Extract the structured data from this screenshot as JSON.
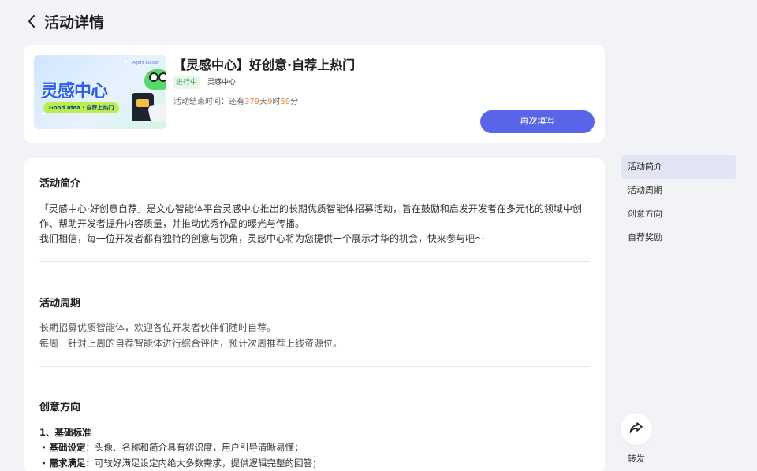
{
  "header": {
    "title": "活动详情"
  },
  "activity": {
    "banner": {
      "title": "灵感中心",
      "pill": "Good Idea · 自荐上热门",
      "small": "Agent Builder"
    },
    "title": "【灵感中心】好创意·自荐上热门",
    "status": "进行中",
    "tag": "灵感中心",
    "end_label": "活动结束时间：还有",
    "days": "379",
    "day_unit": "天",
    "hours": "9",
    "hour_unit": "时",
    "minutes": "59",
    "minute_unit": "分",
    "action": "再次填写"
  },
  "sections": {
    "intro": {
      "heading": "活动简介",
      "p1": "「灵感中心·好创意自荐」是文心智能体平台灵感中心推出的长期优质智能体招募活动，旨在鼓励和启发开发者在多元化的领域中创作、帮助开发者提升内容质量，并推动优秀作品的曝光与传播。",
      "p2": "我们相信，每一位开发者都有独特的创意与视角，灵感中心将为您提供一个展示才华的机会，快来参与吧～"
    },
    "period": {
      "heading": "活动周期",
      "p1": "长期招募优质智能体，欢迎各位开发者伙伴们随时自荐。",
      "p2": "每周一针对上周的自荐智能体进行综合评估，预计次周推荐上线资源位。"
    },
    "direction": {
      "heading": "创意方向",
      "sub": "1、基础标准",
      "b1_key": "基础设定",
      "b1_val": "：头像、名称和简介具有辨识度，用户引导清晰易懂；",
      "b2_key": "需求满足",
      "b2_val": "：可较好满足设定内绝大多数需求，提供逻辑完整的回答；"
    }
  },
  "toc": {
    "items": [
      "活动简介",
      "活动周期",
      "创意方向",
      "自荐奖励"
    ]
  },
  "share": {
    "label": "转发"
  },
  "colors": {
    "accent": "#5865e8",
    "countdown": "#f2843a",
    "status": "#2da44e"
  }
}
